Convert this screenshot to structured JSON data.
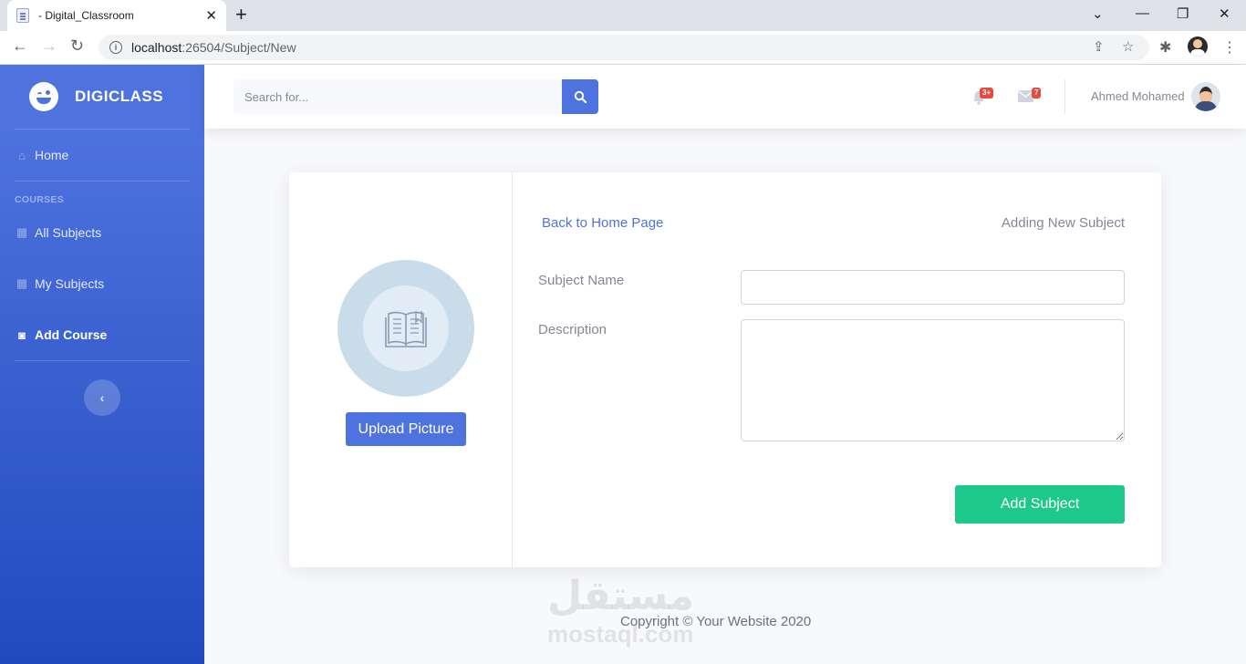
{
  "browser": {
    "tab_title": "- Digital_Classroom",
    "url_host": "localhost",
    "url_rest": ":26504/Subject/New"
  },
  "sidebar": {
    "brand": "DIGICLASS",
    "items": [
      {
        "label": "Home",
        "icon": "home-icon"
      },
      {
        "label": "All Subjects",
        "icon": "cubes-icon"
      },
      {
        "label": "My Subjects",
        "icon": "cubes-icon"
      },
      {
        "label": "Add Course",
        "icon": "book-reader-icon"
      }
    ],
    "section_heading": "COURSES",
    "toggle_icon": "chevron-left-icon"
  },
  "topbar": {
    "search_placeholder": "Search for...",
    "alerts_badge": "3+",
    "messages_badge": "7",
    "user_name": "Ahmed Mohamed"
  },
  "form": {
    "back_link": "Back to Home Page",
    "heading": "Adding New Subject",
    "subject_name_label": "Subject Name",
    "subject_name_value": "",
    "description_label": "Description",
    "description_value": "",
    "upload_button": "Upload Picture",
    "submit_button": "Add Subject"
  },
  "footer": {
    "copyright": "Copyright © Your Website 2020"
  },
  "watermark": {
    "arabic": "مستقل",
    "latin": "mostaql.com"
  },
  "colors": {
    "primary": "#4e73df",
    "success": "#1cc88a",
    "danger": "#e74a3b"
  }
}
